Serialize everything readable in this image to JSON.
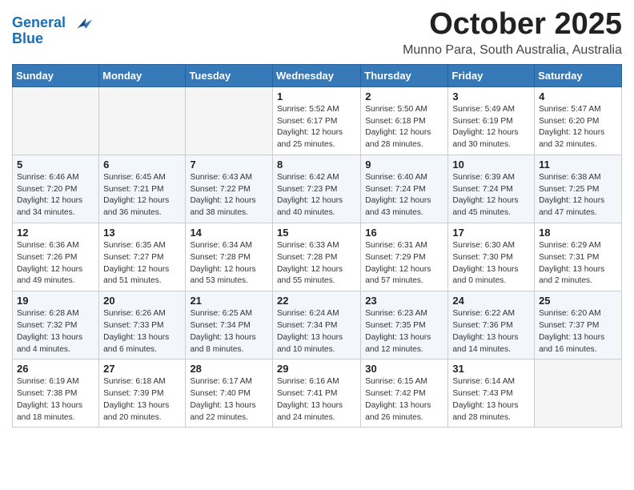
{
  "header": {
    "logo_line1": "General",
    "logo_line2": "Blue",
    "month": "October 2025",
    "location": "Munno Para, South Australia, Australia"
  },
  "days_of_week": [
    "Sunday",
    "Monday",
    "Tuesday",
    "Wednesday",
    "Thursday",
    "Friday",
    "Saturday"
  ],
  "weeks": [
    [
      {
        "day": "",
        "info": ""
      },
      {
        "day": "",
        "info": ""
      },
      {
        "day": "",
        "info": ""
      },
      {
        "day": "1",
        "info": "Sunrise: 5:52 AM\nSunset: 6:17 PM\nDaylight: 12 hours\nand 25 minutes."
      },
      {
        "day": "2",
        "info": "Sunrise: 5:50 AM\nSunset: 6:18 PM\nDaylight: 12 hours\nand 28 minutes."
      },
      {
        "day": "3",
        "info": "Sunrise: 5:49 AM\nSunset: 6:19 PM\nDaylight: 12 hours\nand 30 minutes."
      },
      {
        "day": "4",
        "info": "Sunrise: 5:47 AM\nSunset: 6:20 PM\nDaylight: 12 hours\nand 32 minutes."
      }
    ],
    [
      {
        "day": "5",
        "info": "Sunrise: 6:46 AM\nSunset: 7:20 PM\nDaylight: 12 hours\nand 34 minutes."
      },
      {
        "day": "6",
        "info": "Sunrise: 6:45 AM\nSunset: 7:21 PM\nDaylight: 12 hours\nand 36 minutes."
      },
      {
        "day": "7",
        "info": "Sunrise: 6:43 AM\nSunset: 7:22 PM\nDaylight: 12 hours\nand 38 minutes."
      },
      {
        "day": "8",
        "info": "Sunrise: 6:42 AM\nSunset: 7:23 PM\nDaylight: 12 hours\nand 40 minutes."
      },
      {
        "day": "9",
        "info": "Sunrise: 6:40 AM\nSunset: 7:24 PM\nDaylight: 12 hours\nand 43 minutes."
      },
      {
        "day": "10",
        "info": "Sunrise: 6:39 AM\nSunset: 7:24 PM\nDaylight: 12 hours\nand 45 minutes."
      },
      {
        "day": "11",
        "info": "Sunrise: 6:38 AM\nSunset: 7:25 PM\nDaylight: 12 hours\nand 47 minutes."
      }
    ],
    [
      {
        "day": "12",
        "info": "Sunrise: 6:36 AM\nSunset: 7:26 PM\nDaylight: 12 hours\nand 49 minutes."
      },
      {
        "day": "13",
        "info": "Sunrise: 6:35 AM\nSunset: 7:27 PM\nDaylight: 12 hours\nand 51 minutes."
      },
      {
        "day": "14",
        "info": "Sunrise: 6:34 AM\nSunset: 7:28 PM\nDaylight: 12 hours\nand 53 minutes."
      },
      {
        "day": "15",
        "info": "Sunrise: 6:33 AM\nSunset: 7:28 PM\nDaylight: 12 hours\nand 55 minutes."
      },
      {
        "day": "16",
        "info": "Sunrise: 6:31 AM\nSunset: 7:29 PM\nDaylight: 12 hours\nand 57 minutes."
      },
      {
        "day": "17",
        "info": "Sunrise: 6:30 AM\nSunset: 7:30 PM\nDaylight: 13 hours\nand 0 minutes."
      },
      {
        "day": "18",
        "info": "Sunrise: 6:29 AM\nSunset: 7:31 PM\nDaylight: 13 hours\nand 2 minutes."
      }
    ],
    [
      {
        "day": "19",
        "info": "Sunrise: 6:28 AM\nSunset: 7:32 PM\nDaylight: 13 hours\nand 4 minutes."
      },
      {
        "day": "20",
        "info": "Sunrise: 6:26 AM\nSunset: 7:33 PM\nDaylight: 13 hours\nand 6 minutes."
      },
      {
        "day": "21",
        "info": "Sunrise: 6:25 AM\nSunset: 7:34 PM\nDaylight: 13 hours\nand 8 minutes."
      },
      {
        "day": "22",
        "info": "Sunrise: 6:24 AM\nSunset: 7:34 PM\nDaylight: 13 hours\nand 10 minutes."
      },
      {
        "day": "23",
        "info": "Sunrise: 6:23 AM\nSunset: 7:35 PM\nDaylight: 13 hours\nand 12 minutes."
      },
      {
        "day": "24",
        "info": "Sunrise: 6:22 AM\nSunset: 7:36 PM\nDaylight: 13 hours\nand 14 minutes."
      },
      {
        "day": "25",
        "info": "Sunrise: 6:20 AM\nSunset: 7:37 PM\nDaylight: 13 hours\nand 16 minutes."
      }
    ],
    [
      {
        "day": "26",
        "info": "Sunrise: 6:19 AM\nSunset: 7:38 PM\nDaylight: 13 hours\nand 18 minutes."
      },
      {
        "day": "27",
        "info": "Sunrise: 6:18 AM\nSunset: 7:39 PM\nDaylight: 13 hours\nand 20 minutes."
      },
      {
        "day": "28",
        "info": "Sunrise: 6:17 AM\nSunset: 7:40 PM\nDaylight: 13 hours\nand 22 minutes."
      },
      {
        "day": "29",
        "info": "Sunrise: 6:16 AM\nSunset: 7:41 PM\nDaylight: 13 hours\nand 24 minutes."
      },
      {
        "day": "30",
        "info": "Sunrise: 6:15 AM\nSunset: 7:42 PM\nDaylight: 13 hours\nand 26 minutes."
      },
      {
        "day": "31",
        "info": "Sunrise: 6:14 AM\nSunset: 7:43 PM\nDaylight: 13 hours\nand 28 minutes."
      },
      {
        "day": "",
        "info": ""
      }
    ]
  ]
}
